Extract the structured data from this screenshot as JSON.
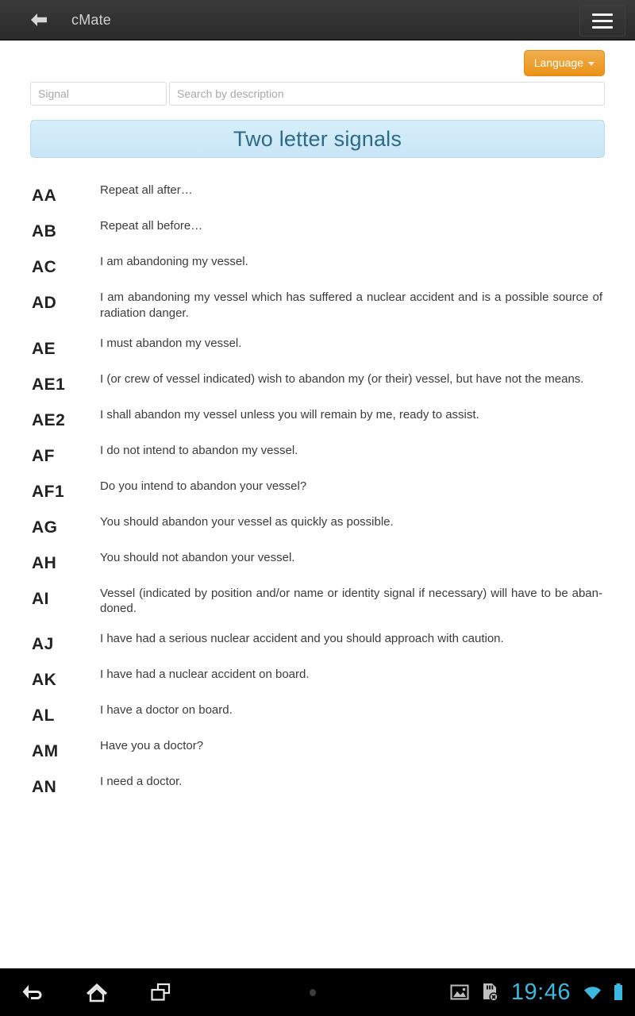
{
  "appbar": {
    "back_icon": "back-arrow-icon",
    "title": "cMate",
    "menu_icon": "hamburger-menu-icon"
  },
  "toolbar": {
    "language_label": "Language",
    "language_caret_icon": "caret-down-icon",
    "language_button_color": "#eb9316"
  },
  "search": {
    "signal_value": "",
    "signal_placeholder": "Signal",
    "description_value": "",
    "description_placeholder": "Search by description"
  },
  "section": {
    "title": "Two letter signals",
    "accent_color": "#2c6a87",
    "background_color": "#cfeaf8"
  },
  "signals": [
    {
      "code": "AA",
      "text": "Repeat all after…"
    },
    {
      "code": "AB",
      "text": "Repeat all before…"
    },
    {
      "code": "AC",
      "text": "I am abandoning my vessel."
    },
    {
      "code": "AD",
      "text": "I am abandoning my vessel which has suffered a nuclear accident and is a possible source of radiation danger."
    },
    {
      "code": "AE",
      "text": "I must abandon my vessel."
    },
    {
      "code": "AE1",
      "text": "I (or crew of vessel indicated) wish to abandon my (or their) vessel, but have not the means."
    },
    {
      "code": "AE2",
      "text": "I shall abandon my vessel unless you will remain by me, ready to assist."
    },
    {
      "code": "AF",
      "text": "I do not intend to abandon my vessel."
    },
    {
      "code": "AF1",
      "text": "Do you intend to abandon your vessel?"
    },
    {
      "code": "AG",
      "text": "You should abandon your vessel as quickly as possible."
    },
    {
      "code": "AH",
      "text": "You should not abandon your vessel."
    },
    {
      "code": "AI",
      "text": "Vessel (indicated by position and/or name or identity signal if necessary) will have to be aban- doned."
    },
    {
      "code": "AJ",
      "text": "I have had a serious nuclear accident and you should approach with caution."
    },
    {
      "code": "AK",
      "text": "I have had a nuclear accident on board."
    },
    {
      "code": "AL",
      "text": "I have a doctor on board."
    },
    {
      "code": "AM",
      "text": "Have you a doctor?"
    },
    {
      "code": "AN",
      "text": "I need a doctor."
    }
  ],
  "navbar": {
    "back_icon": "nav-back-icon",
    "home_icon": "nav-home-icon",
    "recents_icon": "nav-recents-icon",
    "menu_dot_icon": "nav-menu-dot-icon",
    "screenshot_icon": "screenshot-image-icon",
    "sdcard_removed_icon": "sdcard-removed-icon",
    "time": "19:46",
    "wifi_icon": "wifi-icon",
    "battery_icon": "battery-full-icon",
    "status_color": "#3bb9e0"
  }
}
